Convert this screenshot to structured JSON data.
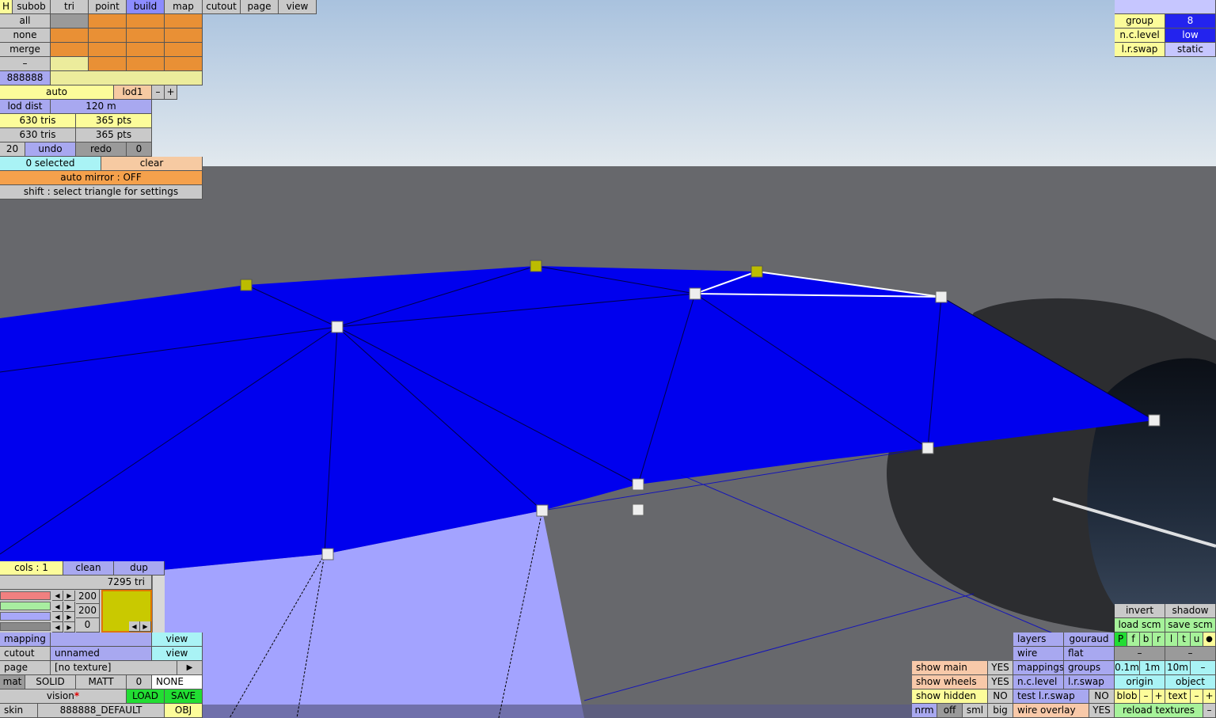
{
  "topmenu": {
    "h": "H",
    "tabs": [
      "subob",
      "tri",
      "point",
      "build",
      "map",
      "cutout",
      "page",
      "view"
    ],
    "active": "build"
  },
  "selrows": [
    "all",
    "none",
    "merge",
    "–"
  ],
  "color_code": "888888",
  "lod": {
    "mode": "auto",
    "name": "lod1",
    "minus": "–",
    "plus": "+",
    "dist_label": "lod dist",
    "dist_value": "120 m"
  },
  "stats": {
    "tris1": "630 tris",
    "pts1": "365 pts",
    "tris2": "630 tris",
    "pts2": "365 pts"
  },
  "undo": {
    "count": "20",
    "undo": "undo",
    "redo": "redo",
    "redo_count": "0"
  },
  "selection": {
    "selected": "0 selected",
    "clear": "clear"
  },
  "auto_mirror": "auto mirror : OFF",
  "hint": "shift : select triangle for settings",
  "topright": {
    "group_label": "group",
    "group_value": "8",
    "nc_label": "n.c.level",
    "nc_value": "low",
    "lr_label": "l.r.swap",
    "lr_value": "static"
  },
  "colors": {
    "cols": "cols : 1",
    "clean": "clean",
    "dup": "dup",
    "tri_count": "7295 tri",
    "r": "200",
    "g": "200",
    "b": "0",
    "swatch": "#c9c900",
    "left_arrow": "◀",
    "right_arrow": "▶"
  },
  "bottomleft": {
    "mapping_label": "mapping",
    "mapping_value": "",
    "view1": "view",
    "cutout_label": "cutout",
    "cutout_value": "unnamed",
    "view2": "view",
    "page_label": "page",
    "page_value": "[no texture]",
    "page_arrow": "▶",
    "mat_label": "mat",
    "solid": "SOLID",
    "matt": "MATT",
    "mat_num": "0",
    "mat_none": "NONE",
    "vision": "vision",
    "vision_star": "*",
    "load": "LOAD",
    "save": "SAVE",
    "skin_label": "skin",
    "skin_value": "888888_DEFAULT",
    "obj": "OBJ"
  },
  "br_show": {
    "main": "show main",
    "main_v": "YES",
    "wheels": "show wheels",
    "wheels_v": "YES",
    "hidden": "show hidden",
    "hidden_v": "NO",
    "nrm": "nrm",
    "off": "off",
    "sml": "sml",
    "big": "big"
  },
  "br_mid": {
    "layers": "layers",
    "gouraud": "gouraud",
    "wire": "wire",
    "flat": "flat",
    "mappings": "mappings",
    "groups": "groups",
    "nclevel": "n.c.level",
    "lrswap": "l.r.swap",
    "test_lr": "test l.r.swap",
    "test_lr_v": "NO",
    "wire_overlay": "wire overlay",
    "wire_overlay_v": "YES"
  },
  "br_right": {
    "invert": "invert",
    "shadow": "shadow",
    "load_scm": "load scm",
    "save_scm": "save scm",
    "letters": [
      "P",
      "f",
      "b",
      "r",
      "l",
      "t",
      "u",
      "●"
    ],
    "dash1": "–",
    "dash2": "–",
    "d01": "0.1m",
    "d1": "1m",
    "d10": "10m",
    "dminus": "–",
    "origin": "origin",
    "object": "object",
    "blob": "blob",
    "bminus": "–",
    "bplus": "+",
    "text": "text",
    "tminus": "–",
    "tplus": "+",
    "reload": "reload textures",
    "rminus": "–"
  }
}
